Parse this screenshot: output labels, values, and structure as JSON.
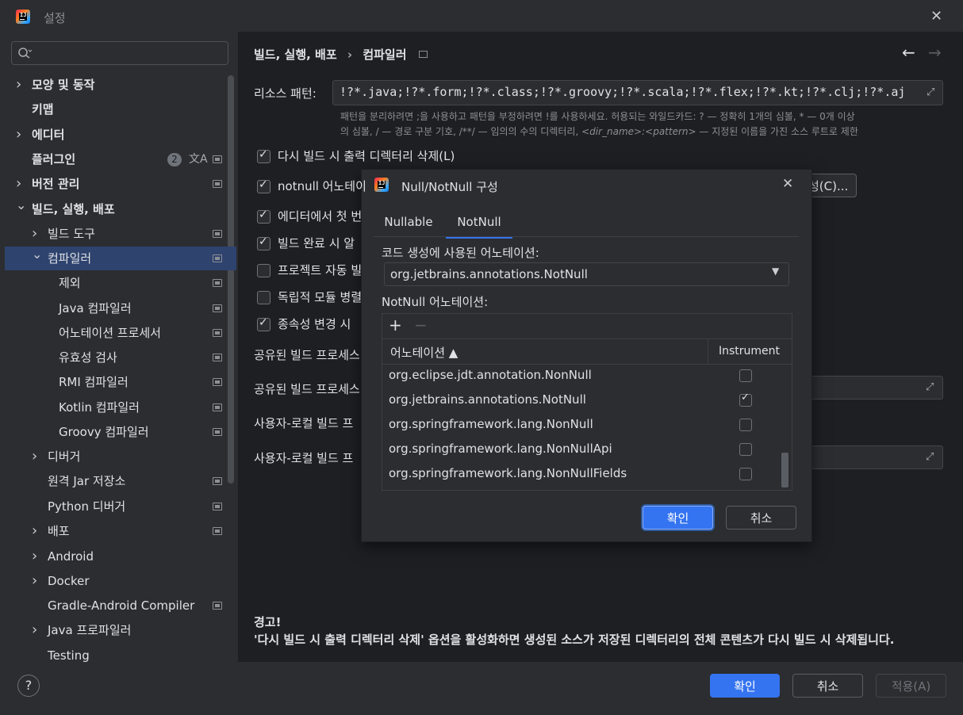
{
  "window": {
    "title": "설정",
    "close": "✕"
  },
  "search": {
    "placeholder": "",
    "icon": "magnifier"
  },
  "sidebar": {
    "items": [
      {
        "label": "모양 및 동작",
        "chevron": "›",
        "badge": ""
      },
      {
        "label": "키맵"
      },
      {
        "label": "에디터",
        "chevron": "›"
      },
      {
        "label": "플러그인",
        "badge": "2"
      },
      {
        "label": "버전 관리",
        "chevron": "›"
      },
      {
        "label": "빌드, 실행, 배포",
        "chevron": "⌄"
      },
      {
        "label": "빌드 도구",
        "chevron": "›"
      },
      {
        "label": "컴파일러",
        "chevron": "⌄"
      },
      {
        "label": "제외"
      },
      {
        "label": "Java 컴파일러"
      },
      {
        "label": "어노테이션 프로세서"
      },
      {
        "label": "유효성 검사"
      },
      {
        "label": "RMI 컴파일러"
      },
      {
        "label": "Kotlin 컴파일러"
      },
      {
        "label": "Groovy 컴파일러"
      },
      {
        "label": "디버거",
        "chevron": "›"
      },
      {
        "label": "원격 Jar 저장소"
      },
      {
        "label": "Python 디버거"
      },
      {
        "label": "배포",
        "chevron": "›"
      },
      {
        "label": "Android",
        "chevron": "›"
      },
      {
        "label": "Docker",
        "chevron": "›"
      },
      {
        "label": "Gradle-Android Compiler"
      },
      {
        "label": "Java 프로파일러",
        "chevron": "›"
      },
      {
        "label": "Testing"
      }
    ]
  },
  "breadcrumb": {
    "part1": "빌드, 실행, 배포",
    "sep": "›",
    "part2": "컴파일러"
  },
  "nav": {
    "back": "←",
    "forward": "→"
  },
  "resource": {
    "label": "리소스 패턴:",
    "value": "!?*.java;!?*.form;!?*.class;!?*.groovy;!?*.scala;!?*.flex;!?*.kt;!?*.clj;!?*.aj",
    "hint1": "패턴을 분리하려면 ;을 사용하고 패턴을 부정하려면 !를 사용하세요. 허용되는 와일드카드: ? — 정확히 1개의 심볼, * — 0개 이상",
    "hint2a": "의 심볼, / — 경로 구분 기호, /**/ — 임의의 수의 디렉터리, ",
    "hint2b": "<dir_name>:<pattern>",
    "hint2c": " — 지정된 이름을 가진 소스 루트로 제한"
  },
  "options": [
    {
      "label": "다시 빌드 시 출력 디렉터리 삭제(L)",
      "checked": true
    },
    {
      "label": "notnull 어노테이",
      "checked": true
    },
    {
      "label": "에디터에서 첫 번",
      "checked": true
    },
    {
      "label": "빌드 완료 시 알",
      "checked": true
    },
    {
      "label": "프로젝트 자동 빌",
      "checked": false
    },
    {
      "label": "독립적 모듈 병렬",
      "checked": false
    },
    {
      "label": "종속성 변경 시",
      "checked": true
    }
  ],
  "configure_button": "성(C)...",
  "shared_rows": [
    {
      "label": "공유된 빌드 프로세스"
    },
    {
      "label": "공유된 빌드 프로세스"
    },
    {
      "label": "사용자-로컬 빌드 프"
    },
    {
      "label": "사용자-로컬 빌드 프"
    }
  ],
  "warning": {
    "title": "경고!",
    "text": "'다시 빌드 시 출력 디렉터리 삭제' 옵션을 활성화하면 생성된 소스가 저장된 디렉터리의 전체 콘텐츠가 다시 빌드 시 삭제됩니다."
  },
  "footer": {
    "help": "?",
    "ok": "확인",
    "cancel": "취소",
    "apply": "적용(A)"
  },
  "dialog": {
    "title": "Null/NotNull 구성",
    "close": "✕",
    "tabs": [
      "Nullable",
      "NotNull"
    ],
    "active_tab": "NotNull",
    "codegen_label": "코드 생성에 사용된 어노테이션:",
    "codegen_value": "org.jetbrains.annotations.NotNull",
    "annotations_label": "NotNull 어노테이션:",
    "add": "+",
    "remove": "−",
    "col_annotation": "어노테이션 ▲",
    "col_instrument": "Instrument",
    "rows": [
      {
        "name": "org.eclipse.jdt.annotation.NonNull",
        "instrument": false
      },
      {
        "name": "org.jetbrains.annotations.NotNull",
        "instrument": true
      },
      {
        "name": "org.springframework.lang.NonNull",
        "instrument": false
      },
      {
        "name": "org.springframework.lang.NonNullApi",
        "instrument": false
      },
      {
        "name": "org.springframework.lang.NonNullFields",
        "instrument": false
      }
    ],
    "ok": "확인",
    "cancel": "취소"
  },
  "colors": {
    "accent": "#3574f0",
    "selection": "#2e436e",
    "bg_main": "#1e1f22",
    "bg_panel": "#2b2d30"
  }
}
